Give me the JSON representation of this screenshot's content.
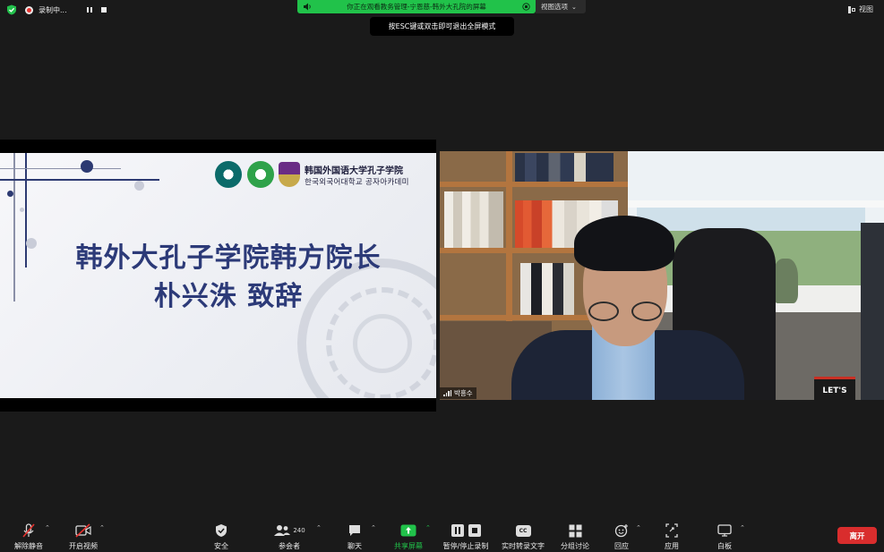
{
  "top": {
    "recording_label": "录制中...",
    "share_banner": "你正在观看教务管理-宁恩慈-韩外大孔院的屏幕",
    "view_options": "视图选项",
    "esc_tip": "按ESC键或双击即可退出全屏模式",
    "view_button": "视图"
  },
  "slide": {
    "title": "韩外大孔子学院韩方院长",
    "subtitle": "朴兴洙 致辞",
    "org_name_cn": "韩国外国语大学孔子学院",
    "org_name_kr": "한국외국어대학교 공자아카데미"
  },
  "video": {
    "participant_name": "박흥수",
    "bag_text": "LET'S"
  },
  "toolbar": {
    "mute": "解除静音",
    "video": "开启视频",
    "security": "安全",
    "participants": "参会者",
    "participants_count": "240",
    "chat": "聊天",
    "share": "共享屏幕",
    "record": "暂停/停止录制",
    "captions": "实时转录文字",
    "cc": "CC",
    "breakout": "分组讨论",
    "reactions": "回应",
    "apps": "应用",
    "whiteboard": "白板",
    "leave": "离开"
  },
  "colors": {
    "share_green": "#21c24a",
    "leave_red": "#d92d2d",
    "slide_navy": "#2c3a78"
  }
}
